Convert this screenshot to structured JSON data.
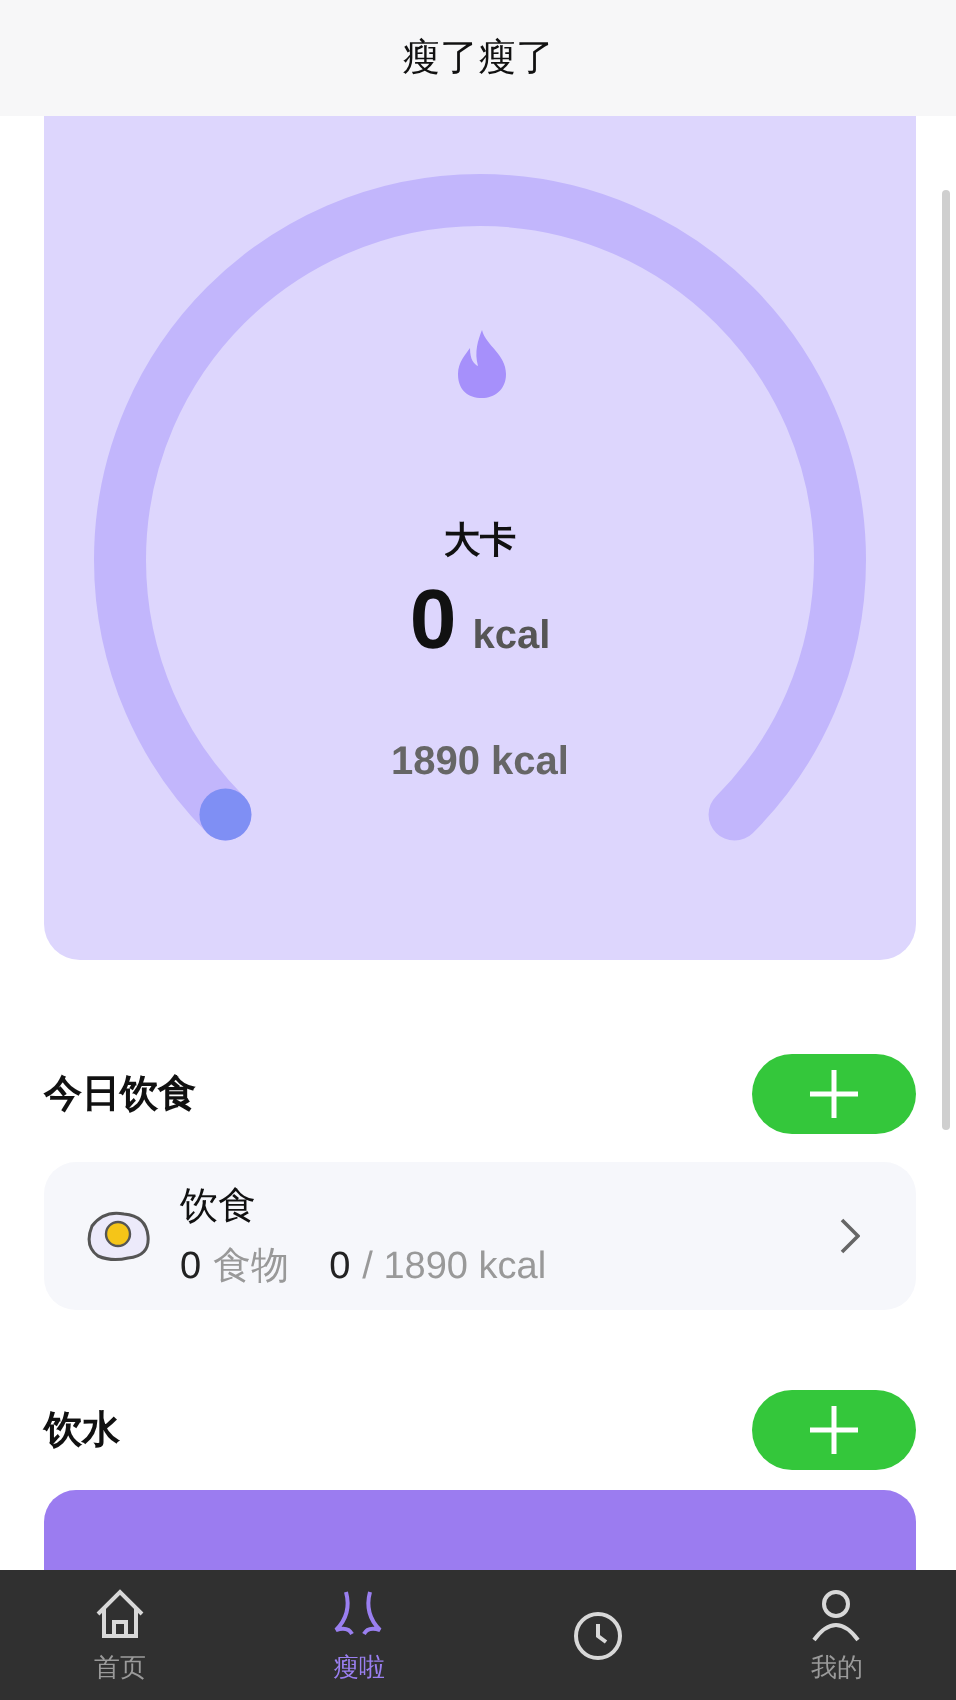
{
  "header": {
    "title": "瘦了瘦了"
  },
  "gauge": {
    "unit_label": "大卡",
    "value": "0",
    "value_unit": "kcal",
    "goal": "1890 kcal"
  },
  "diet": {
    "title": "今日饮食",
    "entry": {
      "name": "饮食",
      "count": "0",
      "count_label": "食物",
      "eaten": "0",
      "goal": "/ 1890 kcal"
    }
  },
  "water": {
    "title": "饮水"
  },
  "tabbar": [
    {
      "kind": "home",
      "label": "首页",
      "selected": false
    },
    {
      "kind": "slim",
      "label": "瘦啦",
      "selected": true
    },
    {
      "kind": "clock",
      "selected": false
    },
    {
      "kind": "user",
      "label": "我的",
      "selected": false
    }
  ]
}
